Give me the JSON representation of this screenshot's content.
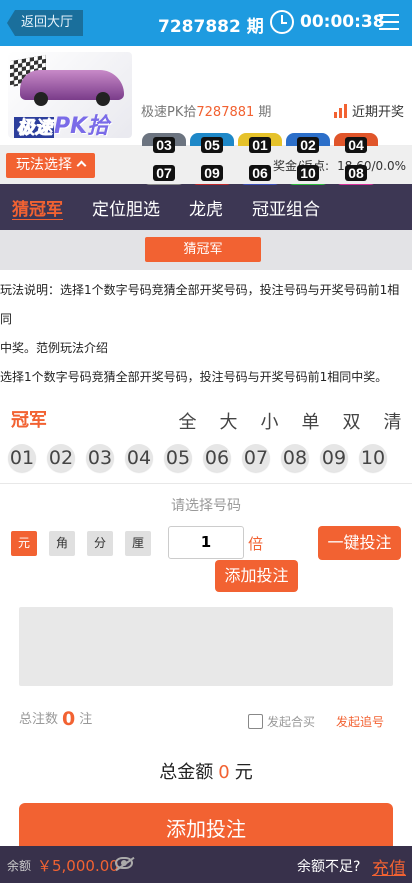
{
  "header": {
    "back_label": "返回大厅",
    "current_period": "7287882 期",
    "countdown": "00:00:38"
  },
  "draw": {
    "logo_text_a": "极速",
    "logo_text_b": "PK拾",
    "last_label": "极速PK拾",
    "last_period": "7287881",
    "last_suffix": "期",
    "trend_label": "近期开奖",
    "results": [
      {
        "num": "03",
        "color": "#6c7480"
      },
      {
        "num": "05",
        "color": "#1e88c8"
      },
      {
        "num": "01",
        "color": "#e6c22a"
      },
      {
        "num": "02",
        "color": "#2c6fc9"
      },
      {
        "num": "04",
        "color": "#e0552a"
      },
      {
        "num": "07",
        "color": "#8c8c8c"
      },
      {
        "num": "09",
        "color": "#c0282a"
      },
      {
        "num": "06",
        "color": "#3b4fb8"
      },
      {
        "num": "10",
        "color": "#2ebc3c"
      },
      {
        "num": "08",
        "color": "#d8309a"
      }
    ]
  },
  "playbar": {
    "play_select": "玩法选择",
    "rebate_label": "奖金/返点:",
    "rebate_value": "18.60/0.0%"
  },
  "tabs": [
    "猜冠军",
    "定位胆选",
    "龙虎",
    "冠亚组合"
  ],
  "subtab": "猜冠军",
  "description": {
    "line1": "玩法说明：选择1个数字号码竞猜全部开奖号码，投注号码与开奖号码前1相同",
    "line2a": "中奖。",
    "line2b": "范例",
    "line2c": "玩法介绍",
    "line3": "选择1个数字号码竞猜全部开奖号码，投注号码与开奖号码前1相同中奖。"
  },
  "pick": {
    "title": "冠军",
    "quick": [
      "全",
      "大",
      "小",
      "单",
      "双",
      "清"
    ],
    "numbers": [
      "01",
      "02",
      "03",
      "04",
      "05",
      "06",
      "07",
      "08",
      "09",
      "10"
    ]
  },
  "bet": {
    "hint": "请选择号码",
    "units": [
      "元",
      "角",
      "分",
      "厘"
    ],
    "multiple": "1",
    "multiple_unit": "倍",
    "onekey_label": "一键投注",
    "add_small_label": "添加投注",
    "total_count_label": "总注数",
    "total_count": "0",
    "total_count_unit": "注",
    "join_label": "发起合买",
    "follow_label": "发起追号",
    "total_amount_label": "总金额",
    "total_amount": "0",
    "total_amount_unit": "元",
    "add_big_label": "添加投注"
  },
  "footer": {
    "balance_label": "余额",
    "balance": "￥5,000.00",
    "low_label": "余额不足?",
    "charge_label": "充值"
  }
}
